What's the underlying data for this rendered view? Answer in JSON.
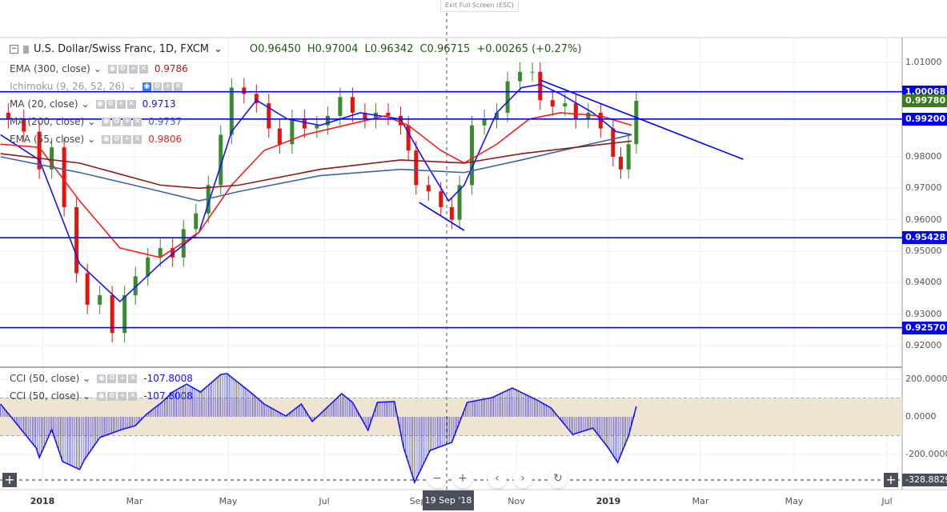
{
  "ui": {
    "exit_fullscreen": "Exit Full Screen (ESC)",
    "crosshair_date": "19 Sep '18",
    "cci_cursor_value": "-328.8829",
    "nav_buttons": {
      "zoom_out": "−",
      "zoom_in": "+",
      "scroll_left": "‹",
      "scroll_right": "›",
      "reset": "↻"
    }
  },
  "symbol": {
    "title": "U.S. Dollar/Swiss Franc, 1D, FXCM",
    "open": "O0.96450",
    "high": "H0.97004",
    "low": "L0.96342",
    "close": "C0.96715",
    "change": "+0.00265 (+0.27%)"
  },
  "indicators": [
    {
      "label": "EMA (300, close)",
      "value": "0.9786",
      "color": "#b01c1c"
    },
    {
      "label": "Ichimoku (9, 26, 52, 26)",
      "value": "",
      "color": "#999999"
    },
    {
      "label": "MA (20, close)",
      "value": "0.9713",
      "color": "#1414ff"
    },
    {
      "label": "MA (200, close)",
      "value": "0.9737",
      "color": "#3f63a8"
    },
    {
      "label": "EMA (55, close)",
      "value": "0.9806",
      "color": "#ff1a1a"
    }
  ],
  "cci_legends": [
    {
      "label": "CCI (50, close)",
      "value": "-107.8008"
    },
    {
      "label": "CCI (50, close)",
      "value": "-107.8008"
    }
  ],
  "price_labels": [
    {
      "value": "1.00068",
      "color": "#0000ff"
    },
    {
      "value": "0.99780",
      "color": "#3c7a1e"
    },
    {
      "value": "0.99200",
      "color": "#0000ff"
    },
    {
      "value": "0.95428",
      "color": "#0000ff"
    },
    {
      "value": "0.92570",
      "color": "#0000ff"
    }
  ],
  "chart_data": [
    {
      "type": "candlestick",
      "pane": "price",
      "ylim": [
        0.9155,
        1.0155
      ],
      "y_ticks": [
        "1.01000",
        "0.98000",
        "0.97000",
        "0.96000",
        "0.95000",
        "0.94000",
        "0.93000",
        "0.92000"
      ],
      "x_ticks": [
        "2018",
        "Mar",
        "May",
        "Jul",
        "Sep",
        "Nov",
        "2019",
        "Mar",
        "May",
        "Jul"
      ],
      "grid": true,
      "horizontal_lines": [
        1.00068,
        0.992,
        0.95428,
        0.9257
      ],
      "trendlines": [
        [
          [
            "2018-09-01",
            0.9655
          ],
          [
            "2018-09-30",
            0.9566
          ]
        ],
        [
          [
            "2018-11-18",
            1.0044
          ],
          [
            "2019-03-29",
            0.9792
          ]
        ]
      ],
      "closes": [
        [
          "2017-12-10",
          0.992
        ],
        [
          "2017-12-20",
          0.988
        ],
        [
          "2017-12-30",
          0.976
        ],
        [
          "2018-01-07",
          0.983
        ],
        [
          "2018-01-15",
          0.964
        ],
        [
          "2018-01-23",
          0.943
        ],
        [
          "2018-01-30",
          0.933
        ],
        [
          "2018-02-07",
          0.936
        ],
        [
          "2018-02-15",
          0.924
        ],
        [
          "2018-02-23",
          0.936
        ],
        [
          "2018-03-02",
          0.942
        ],
        [
          "2018-03-10",
          0.948
        ],
        [
          "2018-03-18",
          0.951
        ],
        [
          "2018-03-26",
          0.948
        ],
        [
          "2018-04-02",
          0.957
        ],
        [
          "2018-04-10",
          0.962
        ],
        [
          "2018-04-18",
          0.971
        ],
        [
          "2018-04-26",
          0.987
        ],
        [
          "2018-05-03",
          1.002
        ],
        [
          "2018-05-11",
          1.0
        ],
        [
          "2018-05-19",
          0.997
        ],
        [
          "2018-05-27",
          0.989
        ],
        [
          "2018-06-03",
          0.984
        ],
        [
          "2018-06-11",
          0.992
        ],
        [
          "2018-06-19",
          0.989
        ],
        [
          "2018-06-27",
          0.99
        ],
        [
          "2018-07-04",
          0.993
        ],
        [
          "2018-07-12",
          0.999
        ],
        [
          "2018-07-20",
          0.994
        ],
        [
          "2018-07-28",
          0.992
        ],
        [
          "2018-08-04",
          0.994
        ],
        [
          "2018-08-12",
          0.993
        ],
        [
          "2018-08-20",
          0.99
        ],
        [
          "2018-08-25",
          0.982
        ],
        [
          "2018-08-30",
          0.971
        ],
        [
          "2018-09-07",
          0.969
        ],
        [
          "2018-09-15",
          0.964
        ],
        [
          "2018-09-22",
          0.96
        ],
        [
          "2018-09-27",
          0.971
        ],
        [
          "2018-10-05",
          0.99
        ],
        [
          "2018-10-13",
          0.992
        ],
        [
          "2018-10-21",
          0.994
        ],
        [
          "2018-10-28",
          1.004
        ],
        [
          "2018-11-05",
          1.007
        ],
        [
          "2018-11-13",
          1.007
        ],
        [
          "2018-11-18",
          0.998
        ],
        [
          "2018-11-26",
          0.996
        ],
        [
          "2018-12-04",
          0.997
        ],
        [
          "2018-12-11",
          0.992
        ],
        [
          "2018-12-19",
          0.994
        ],
        [
          "2018-12-27",
          0.989
        ],
        [
          "2019-01-04",
          0.98
        ],
        [
          "2019-01-09",
          0.976
        ],
        [
          "2019-01-14",
          0.984
        ],
        [
          "2019-01-19",
          0.9978
        ]
      ],
      "series": [
        {
          "name": "MA (20, close)",
          "color": "#1414ff",
          "points": [
            [
              "2017-12-05",
              0.987
            ],
            [
              "2017-12-30",
              0.979
            ],
            [
              "2018-01-25",
              0.946
            ],
            [
              "2018-02-20",
              0.934
            ],
            [
              "2018-03-18",
              0.946
            ],
            [
              "2018-04-12",
              0.956
            ],
            [
              "2018-05-03",
              0.988
            ],
            [
              "2018-05-19",
              0.998
            ],
            [
              "2018-06-08",
              0.992
            ],
            [
              "2018-06-29",
              0.99
            ],
            [
              "2018-07-25",
              0.994
            ],
            [
              "2018-08-20",
              0.992
            ],
            [
              "2018-09-04",
              0.979
            ],
            [
              "2018-09-20",
              0.966
            ],
            [
              "2018-09-30",
              0.971
            ],
            [
              "2018-10-21",
              0.994
            ],
            [
              "2018-11-06",
              1.002
            ],
            [
              "2018-11-18",
              1.003
            ],
            [
              "2018-12-01",
              1.0
            ],
            [
              "2018-12-22",
              0.994
            ],
            [
              "2019-01-06",
              0.988
            ],
            [
              "2019-01-16",
              0.987
            ]
          ]
        },
        {
          "name": "EMA (55, close)",
          "color": "#ff1a1a",
          "points": [
            [
              "2017-12-05",
              0.984
            ],
            [
              "2017-12-30",
              0.983
            ],
            [
              "2018-01-25",
              0.966
            ],
            [
              "2018-02-20",
              0.951
            ],
            [
              "2018-03-18",
              0.948
            ],
            [
              "2018-04-12",
              0.956
            ],
            [
              "2018-05-03",
              0.971
            ],
            [
              "2018-05-24",
              0.982
            ],
            [
              "2018-06-19",
              0.987
            ],
            [
              "2018-07-15",
              0.99
            ],
            [
              "2018-08-10",
              0.993
            ],
            [
              "2018-08-25",
              0.99
            ],
            [
              "2018-09-15",
              0.982
            ],
            [
              "2018-09-30",
              0.978
            ],
            [
              "2018-10-21",
              0.984
            ],
            [
              "2018-11-11",
              0.992
            ],
            [
              "2018-12-01",
              0.994
            ],
            [
              "2018-12-27",
              0.993
            ],
            [
              "2019-01-16",
              0.99
            ]
          ]
        },
        {
          "name": "MA (200, close)",
          "color": "#3f63a8",
          "points": [
            [
              "2017-12-05",
              0.98
            ],
            [
              "2018-01-25",
              0.975
            ],
            [
              "2018-03-18",
              0.969
            ],
            [
              "2018-04-12",
              0.966
            ],
            [
              "2018-05-08",
              0.969
            ],
            [
              "2018-06-29",
              0.974
            ],
            [
              "2018-08-20",
              0.976
            ],
            [
              "2018-09-30",
              0.975
            ],
            [
              "2018-11-06",
              0.979
            ],
            [
              "2018-12-11",
              0.983
            ],
            [
              "2019-01-16",
              0.987
            ]
          ]
        },
        {
          "name": "EMA (300, close)",
          "color": "#8b1a1a",
          "points": [
            [
              "2017-12-05",
              0.981
            ],
            [
              "2018-01-25",
              0.978
            ],
            [
              "2018-03-18",
              0.971
            ],
            [
              "2018-04-12",
              0.97
            ],
            [
              "2018-05-08",
              0.971
            ],
            [
              "2018-06-29",
              0.976
            ],
            [
              "2018-08-20",
              0.979
            ],
            [
              "2018-09-30",
              0.978
            ],
            [
              "2018-11-06",
              0.981
            ],
            [
              "2018-12-11",
              0.983
            ],
            [
              "2019-01-16",
              0.985
            ]
          ]
        }
      ]
    },
    {
      "type": "histogram-line",
      "pane": "CCI",
      "name": "CCI (50, close)",
      "color": "#1414ff",
      "ylim": [
        -360,
        260
      ],
      "y_ticks": [
        "200.0000",
        "0.0000",
        "-200.0000"
      ],
      "band": [
        -100,
        100
      ],
      "points": [
        [
          "2017-12-05",
          68
        ],
        [
          "2017-12-28",
          -166
        ],
        [
          "2017-12-30",
          -217
        ],
        [
          "2018-01-07",
          -68
        ],
        [
          "2018-01-14",
          -238
        ],
        [
          "2018-01-25",
          -280
        ],
        [
          "2018-01-28",
          -230
        ],
        [
          "2018-02-07",
          -110
        ],
        [
          "2018-02-21",
          -68
        ],
        [
          "2018-03-02",
          -47
        ],
        [
          "2018-03-09",
          13
        ],
        [
          "2018-03-19",
          77
        ],
        [
          "2018-03-26",
          132
        ],
        [
          "2018-04-04",
          174
        ],
        [
          "2018-04-13",
          132
        ],
        [
          "2018-04-26",
          225
        ],
        [
          "2018-04-30",
          230
        ],
        [
          "2018-05-15",
          132
        ],
        [
          "2018-05-24",
          68
        ],
        [
          "2018-06-07",
          4
        ],
        [
          "2018-06-17",
          68
        ],
        [
          "2018-06-24",
          -25
        ],
        [
          "2018-07-13",
          123
        ],
        [
          "2018-07-20",
          77
        ],
        [
          "2018-07-30",
          -72
        ],
        [
          "2018-08-05",
          77
        ],
        [
          "2018-08-16",
          81
        ],
        [
          "2018-08-22",
          -166
        ],
        [
          "2018-08-29",
          -349
        ],
        [
          "2018-09-08",
          -179
        ],
        [
          "2018-09-22",
          -136
        ],
        [
          "2018-10-02",
          77
        ],
        [
          "2018-10-18",
          102
        ],
        [
          "2018-10-31",
          153
        ],
        [
          "2018-11-16",
          89
        ],
        [
          "2018-11-25",
          47
        ],
        [
          "2018-12-09",
          -94
        ],
        [
          "2018-12-22",
          -60
        ],
        [
          "2019-01-01",
          -166
        ],
        [
          "2019-01-07",
          -243
        ],
        [
          "2019-01-14",
          -102
        ],
        [
          "2019-01-19",
          55
        ]
      ]
    }
  ]
}
